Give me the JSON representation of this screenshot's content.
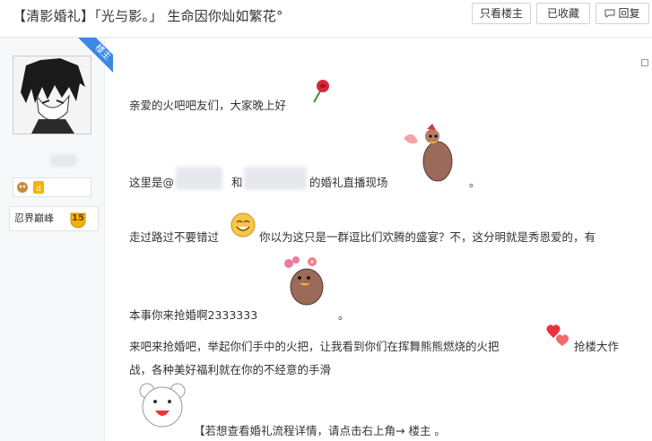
{
  "header": {
    "title": "【清影婚礼】「光与影。」 生命因你灿如繁花°",
    "only_owner_label": "只看楼主",
    "collect_label": "已收藏",
    "reply_label": "回复"
  },
  "author": {
    "ribbon_label": "楼主",
    "rank_name": "忍界巅峰",
    "rank_level": "15"
  },
  "post": {
    "line1": "亲爱的火吧吧友们，大家晚上好",
    "line2_prefix": "这里是@",
    "line2_and": "和",
    "line2_suffix": "的婚礼直播现场",
    "line2_dot": "。",
    "line3a": "走过路过不要错过",
    "line3b": "你以为这只是一群逗比们欢腾的盛宴？不，这分明就是秀恩爱的，有",
    "line4": "本事你来抢婚啊2333333",
    "line4_dot": "。",
    "line5a": "来吧来抢婚吧，举起你们手中的火把，让我看到你们在挥舞熊熊燃烧的火把",
    "line5b": "抢楼大作",
    "line6": "战，各种美好福利就在你的不经意的手滑",
    "line7": "【若想查看婚礼流程详情，请点击右上角→ 楼主 。"
  },
  "icons": [
    "rose-icon",
    "chicken-sticker-icon",
    "smiley-icon",
    "chicken-flower-sticker-icon",
    "hearts-icon",
    "bear-sticker-icon",
    "edit-icon",
    "chat-icon"
  ]
}
